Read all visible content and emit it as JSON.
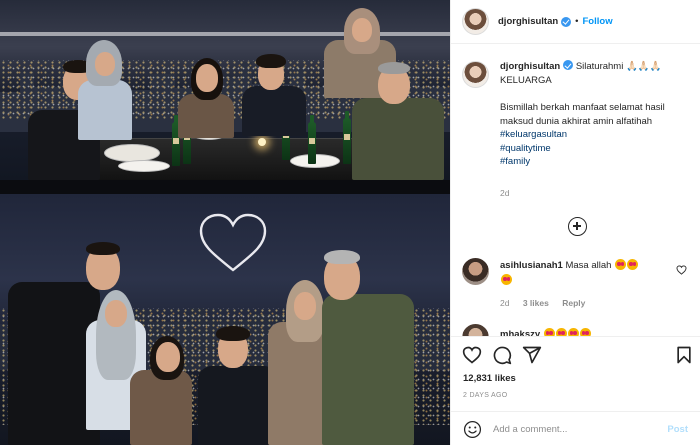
{
  "header": {
    "username": "djorghisultan",
    "separator": "•",
    "follow_label": "Follow"
  },
  "caption": {
    "username": "djorghisultan",
    "title_text": "Silaturahmi 🙏🏻🙏🏻🙏🏻 KELUARGA",
    "body_text": "Bismillah berkah manfaat selamat hasil maksud dunia akhirat amin alfatihah",
    "hashtags": [
      "#keluargasultan",
      "#qualitytime",
      "#family"
    ],
    "age": "2d"
  },
  "comments": [
    {
      "username": "asihlusianah1",
      "text": "Masa allah",
      "emoji_count": 3,
      "age": "2d",
      "likes_label": "3 likes",
      "reply_label": "Reply"
    },
    {
      "username": "mhakszy"
    }
  ],
  "actions": {
    "likes": "12,831 likes",
    "posted_ago": "2 DAYS AGO",
    "comment_placeholder": "Add a comment...",
    "post_label": "Post"
  },
  "icons": {
    "like": "heart-icon",
    "comment": "comment-icon",
    "share": "share-icon",
    "save": "bookmark-icon",
    "more_comments": "plus-circle-icon",
    "emoji": "smiley-icon",
    "verified": "verified-badge-icon"
  },
  "colors": {
    "follow": "#0095f6",
    "hashtag": "#00376b",
    "verified": "#3897f0",
    "muted": "#8e8e8e",
    "post_disabled": "#b2dffc"
  }
}
